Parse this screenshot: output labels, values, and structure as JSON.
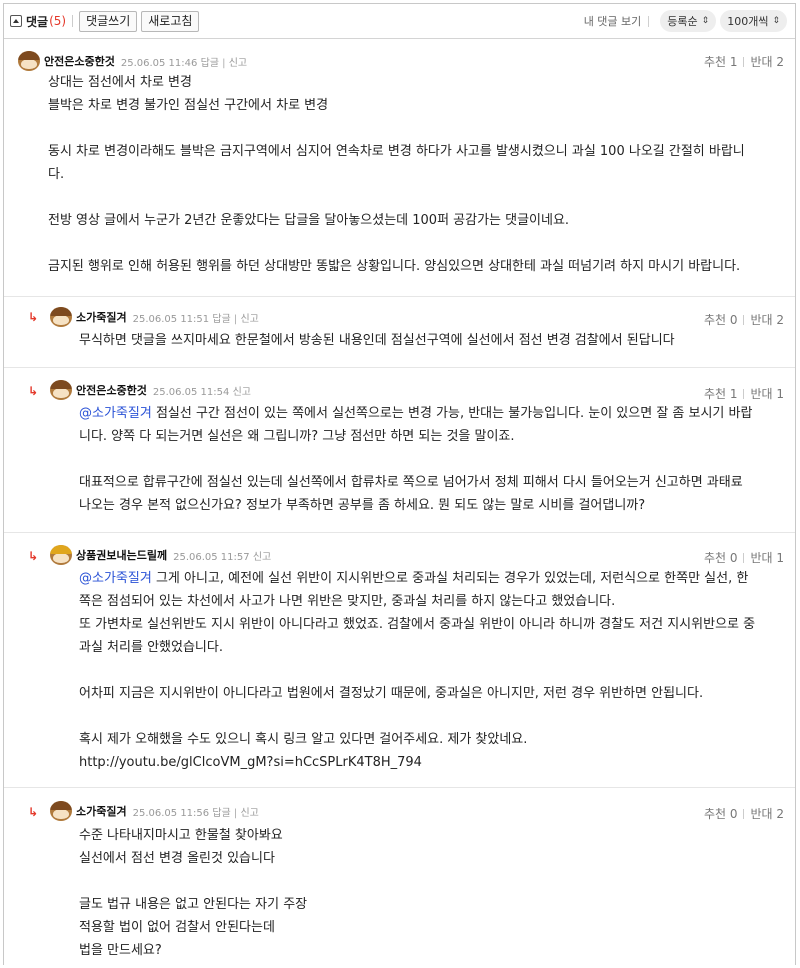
{
  "toolbar": {
    "title": "댓글",
    "count": "(5)",
    "write_label": "댓글쓰기",
    "refresh_label": "새로고침",
    "my_comments_label": "내 댓글 보기",
    "sort_value": "등록순",
    "page_size_value": "100개씩"
  },
  "comments": [
    {
      "nick": "안전은소중한것",
      "date": "25.06.05 11:46",
      "reply_label": "답글",
      "report_label": "신고",
      "up_label": "추천 1",
      "down_label": "반대 2",
      "lines": [
        "상대는 점선에서 차로 변경",
        "블박은 차로 변경 불가인 점실선 구간에서 차로 변경",
        "",
        "동시 차로 변경이라해도 블박은 금지구역에서 심지어 연속차로 변경 하다가 사고를 발생시켰으니 과실 100 나오길 간절히 바랍니",
        "다.",
        "",
        "전방 영상 글에서 누군가 2년간 운좋았다는 답글을 달아놓으셨는데 100퍼 공감가는 댓글이네요.",
        "",
        "금지된 행위로 인해 허용된 행위를 하던 상대방만 똥밟은 상황입니다. 양심있으면 상대한테 과실 떠넘기려 하지 마시기 바랍니다."
      ]
    },
    {
      "nick": "소가죽질겨",
      "date": "25.06.05 11:51",
      "reply_label": "답글",
      "report_label": "신고",
      "up_label": "추천 0",
      "down_label": "반대 2",
      "lines": [
        "무식하면 댓글을 쓰지마세요 한문철에서 방송된 내용인데 점실선구역에 실선에서 점선 변경 검찰에서 된답니다"
      ]
    },
    {
      "nick": "안전은소중한것",
      "date": "25.06.05 11:54",
      "report_label": "신고",
      "up_label": "추천 1",
      "down_label": "반대 1",
      "mention": "@소가죽질겨",
      "first_line_rest": " 점실선 구간 점선이 있는 쪽에서 실선쪽으로는 변경 가능, 반대는 불가능입니다. 눈이 있으면 잘 좀 보시기 바랍",
      "lines": [
        "니다. 양쪽 다 되는거면 실선은 왜 그립니까? 그냥 점선만 하면 되는 것을 말이죠.",
        "",
        "대표적으로 합류구간에 점실선 있는데 실선쪽에서 합류차로 쪽으로 넘어가서 정체 피해서 다시 들어오는거 신고하면 과태료",
        "나오는 경우 본적 없으신가요? 정보가 부족하면 공부를 좀 하세요. 뭔 되도 않는 말로 시비를 걸어댑니까?"
      ]
    },
    {
      "nick": "상품권보내는드릴께",
      "date": "25.06.05 11:57",
      "report_label": "신고",
      "up_label": "추천 0",
      "down_label": "반대 1",
      "mention": "@소가죽질겨",
      "first_line_rest": " 그게 아니고, 예전에 실선 위반이 지시위반으로 중과실 처리되는 경우가 있었는데, 저런식으로 한쪽만 실선, 한",
      "lines": [
        "쪽은 점섬되어 있는 차선에서 사고가 나면 위반은 맞지만, 중과실 처리를 하지 않는다고 했었습니다.",
        "또 가변차로 실선위반도 지시 위반이 아니다라고 했었죠. 검찰에서 중과실 위반이 아니라 하니까 경찰도 저건 지시위반으로 중",
        "과실 처리를 안했었습니다.",
        "",
        "어차피 지금은 지시위반이 아니다라고 법원에서 결정났기 때문에, 중과실은 아니지만, 저런 경우 위반하면 안됩니다.",
        "",
        "혹시 제가 오해했을 수도 있으니 혹시 링크 알고 있다면 걸어주세요. 제가 찾았네요.",
        "http://youtu.be/glClcoVM_gM?si=hCcSPLrK4T8H_794"
      ]
    },
    {
      "nick": "소가죽질겨",
      "date": "25.06.05 11:56",
      "reply_label": "답글",
      "report_label": "신고",
      "up_label": "추천 0",
      "down_label": "반대 2",
      "lines": [
        "수준 나타내지마시고 한물철 찾아봐요",
        "실선에서 점선 변경 올린것 있습니다",
        "",
        "글도 법규 내용은 없고 안된다는 자기 주장",
        "적용할 법이 없어 검찰서 안된다는데",
        "법을 만드세요?"
      ]
    }
  ]
}
